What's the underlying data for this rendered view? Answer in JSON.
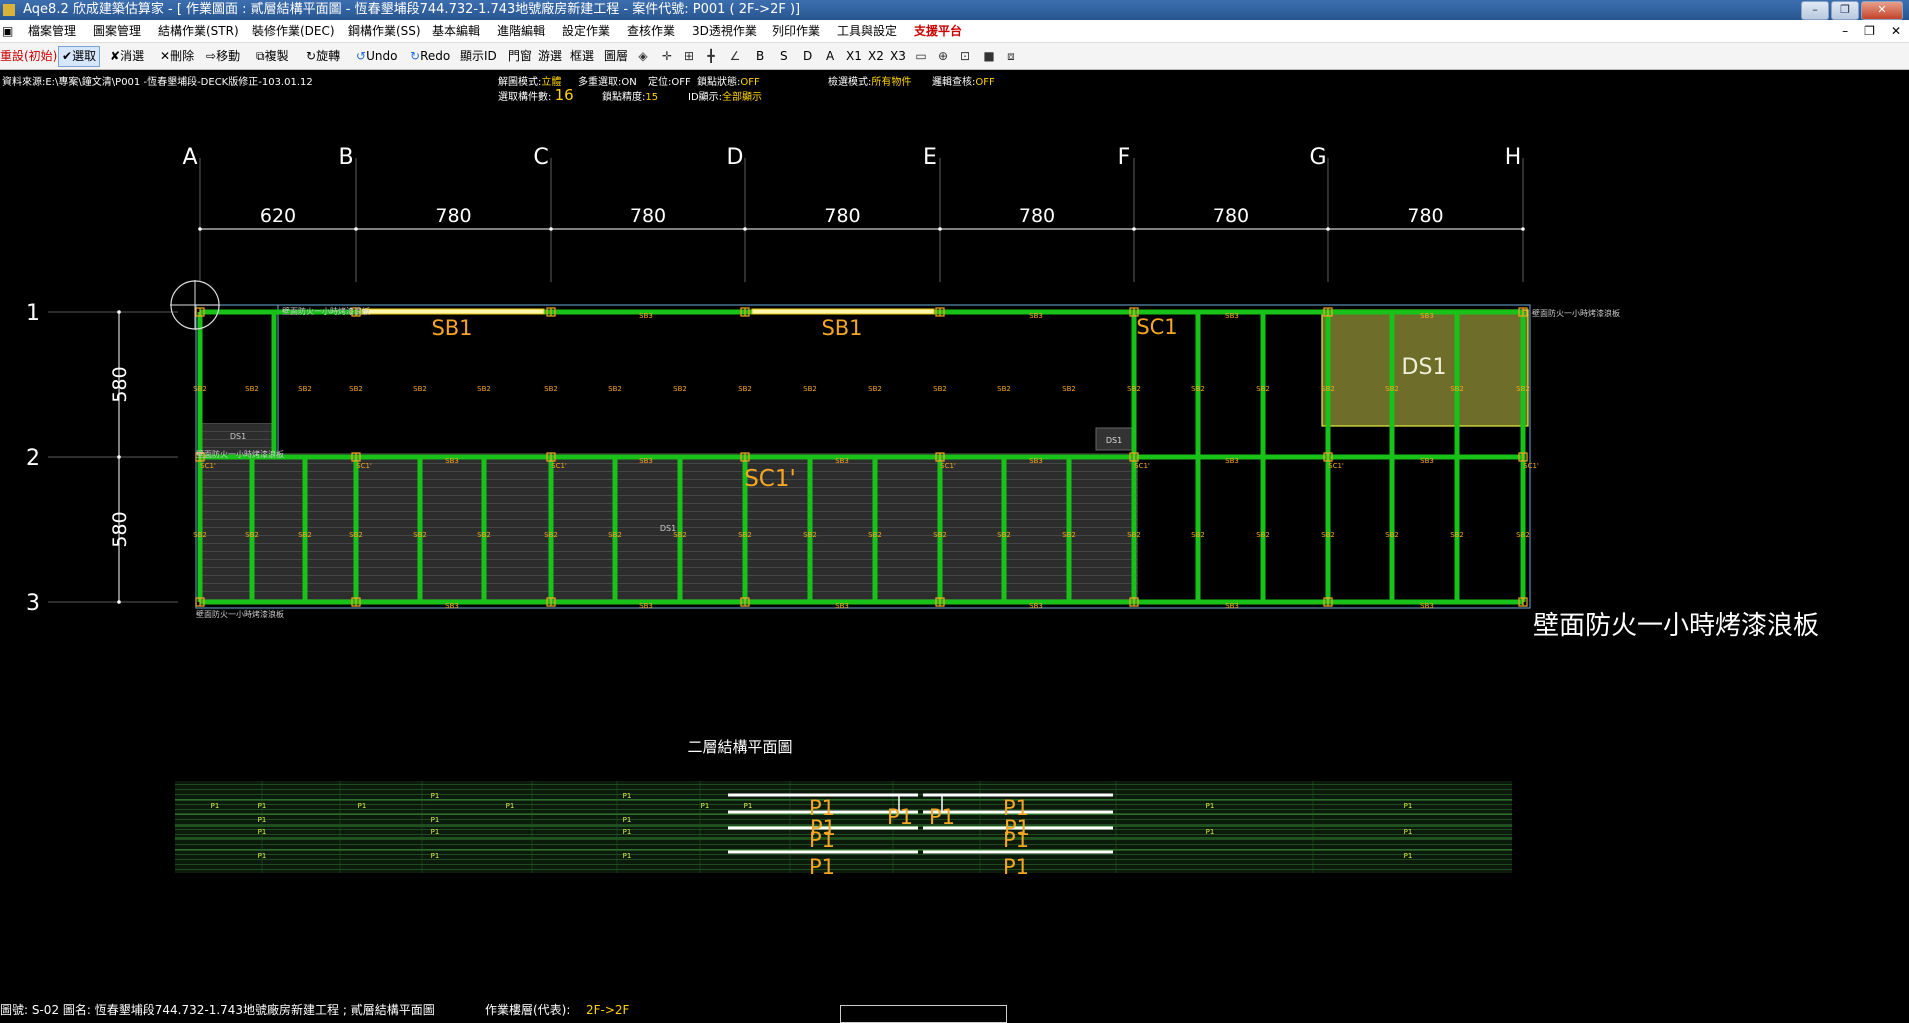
{
  "window": {
    "title": "Aqe8.2 欣成建築估算家 - [ 作業圖面 : 貳層結構平面圖 - 恆春墾埔段744.732-1.743地號廠房新建工程 - 案件代號: P001 ( 2F->2F )]",
    "buttons": [
      "–",
      "❐",
      "✕"
    ]
  },
  "menu": {
    "items": [
      "檔案管理",
      "圖案管理",
      "結構作業(STR)",
      "裝修作業(DEC)",
      "鋼構作業(SS)",
      "基本編輯",
      "進階編輯",
      "設定作業",
      "查核作業",
      "3D透視作業",
      "列印作業",
      "工具與設定",
      "支援平台"
    ],
    "right_controls": [
      "–",
      "❐",
      "✕"
    ]
  },
  "toolbar": {
    "reset": "重設(初始)",
    "select": "選取",
    "deselect": "消選",
    "delete": "刪除",
    "move": "移動",
    "copy": "複製",
    "rotate": "旋轉",
    "undo": "Undo",
    "redo": "Redo",
    "show_id": "顯示ID",
    "door_window": "門窗",
    "wander_select": "游選",
    "box_select": "框選",
    "layer": "圖層",
    "letters": [
      "B",
      "S",
      "D",
      "A",
      "X1",
      "X2",
      "X3"
    ]
  },
  "info": {
    "source": "資料來源:E:\\專案\\鐘文清\\P001 -恆春墾埔段-DECK版修正-103.01.12",
    "mode_label": "解圖模式:",
    "mode_value": "立體",
    "multi_select": "多重選取:ON",
    "position": "定位:OFF",
    "lock_status_label": "鎖點狀態:",
    "lock_status_value": "OFF",
    "pick_mode_label": "檢選模式:",
    "pick_mode_value": "所有物件",
    "logic_check_label": "邏輯查核:",
    "logic_check_value": "OFF",
    "selected_count_label": "選取構件數:",
    "selected_count_value": "16",
    "lock_precision_label": "鎖點精度:",
    "lock_precision_value": "15",
    "id_display_label": "ID顯示:",
    "id_display_value": "全部顯示"
  },
  "drawing": {
    "grid_columns": [
      "A",
      "B",
      "C",
      "D",
      "E",
      "F",
      "G",
      "H"
    ],
    "grid_rows": [
      "1",
      "2",
      "3"
    ],
    "col_dims": [
      "620",
      "780",
      "780",
      "780",
      "780",
      "780",
      "780"
    ],
    "row_dims": [
      "580",
      "580"
    ],
    "labels": {
      "sb1_a": "SB1",
      "sb1_b": "SB1",
      "sc1": "SC1",
      "ds1": "DS1",
      "sc1p": "SC1'",
      "ds1_small": "DS1",
      "ds1_tag": "DS1",
      "ds1_left": "DS1",
      "wall_note": "壁面防火一小時烤漆浪板",
      "wall_note_small": "壁面防火一小時烤漆浪板",
      "plan_title": "二層結構平面圖",
      "sb2": "SB2",
      "sb3": "SB3",
      "sc1_small": "SC1'",
      "p1": "P1"
    },
    "colors": {
      "beam": "#19c219",
      "label": "#f5a623",
      "slab": "#d9ea4a",
      "bg": "#000000"
    }
  },
  "status": {
    "drawing_label": "圖號: S-02 圖名: 恆春墾埔段744.732-1.743地號廠房新建工程 ; 貳層結構平面圖",
    "floor_label": "作業樓層(代表):",
    "floor_value": "2F->2F"
  }
}
